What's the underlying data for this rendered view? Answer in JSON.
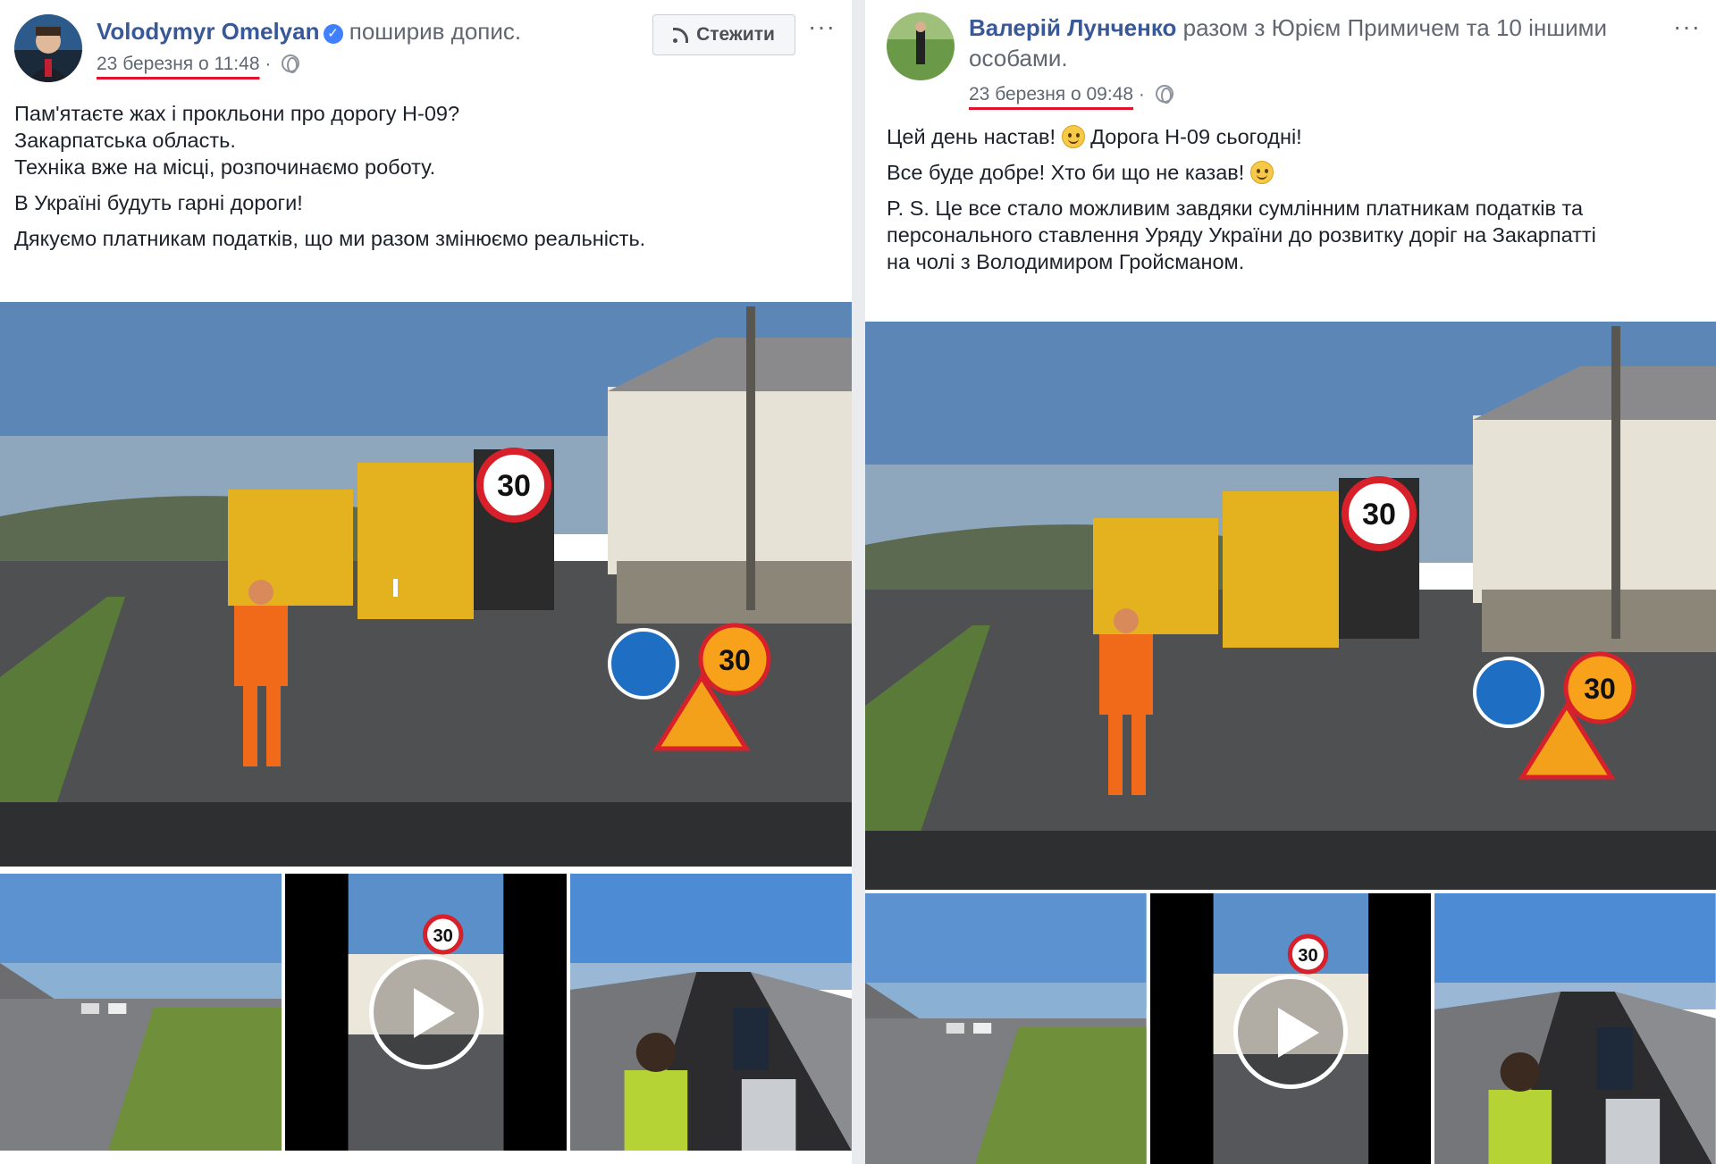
{
  "colors": {
    "link": "#385898",
    "muted": "#616770",
    "highlight_underline": "#e2142d",
    "page_bg": "#e9ebee"
  },
  "posts": [
    {
      "author": "Volodymyr Omelyan",
      "verified": true,
      "action": "поширив допис.",
      "time": "23 березня о 11:48",
      "privacy_icon": "globe-icon",
      "follow_label": "Стежити",
      "follow_icon": "rss-icon",
      "more_label": "···",
      "paragraphs": [
        [
          "Пам'ятаєте жах і прокльони про дорогу Н-09?",
          "Закарпатська область.",
          "Техніка вже на місці, розпочинаємо роботу."
        ],
        [
          "В Україні будуть гарні дороги!"
        ],
        [
          "Дякуємо платникам податків, що ми разом змінюємо реальність."
        ]
      ],
      "photo": {
        "sign_speed": "30",
        "sign_speed_small": "30",
        "sign_speed_board": "30"
      },
      "thumbs": [
        {
          "kind": "photo",
          "subject": "road-with-cars"
        },
        {
          "kind": "video",
          "subject": "sign-30",
          "sign_speed": "30",
          "play_icon": "play-icon"
        },
        {
          "kind": "photo",
          "subject": "interview-on-road"
        }
      ]
    },
    {
      "author": "Валерій Лунченко",
      "with_text": "разом з Юрієм Примичем та 10 іншими особами.",
      "with_line1": "разом з Юрієм Примичем та 10 іншими",
      "with_line2": "особами.",
      "time": "23 березня о 09:48",
      "privacy_icon": "globe-icon",
      "more_label": "···",
      "paragraphs": [
        [
          "Цей день настав!",
          "Дорога Н-09 сьогодні!"
        ],
        [
          "Все буде добре! Хто би що не казав!"
        ],
        [
          "P. S. Це все стало можливим завдяки сумлінним платникам податків та",
          "персонального ставлення Уряду України до розвитку доріг на Закарпатті",
          "на чолі з Володимиром Гройсманом."
        ]
      ],
      "photo": {
        "sign_speed": "30",
        "sign_speed_small": "30",
        "sign_speed_board": "30"
      },
      "thumbs": [
        {
          "kind": "photo",
          "subject": "road-with-cars"
        },
        {
          "kind": "video",
          "subject": "sign-30",
          "sign_speed": "30",
          "play_icon": "play-icon"
        },
        {
          "kind": "photo",
          "subject": "interview-on-road"
        }
      ]
    }
  ]
}
